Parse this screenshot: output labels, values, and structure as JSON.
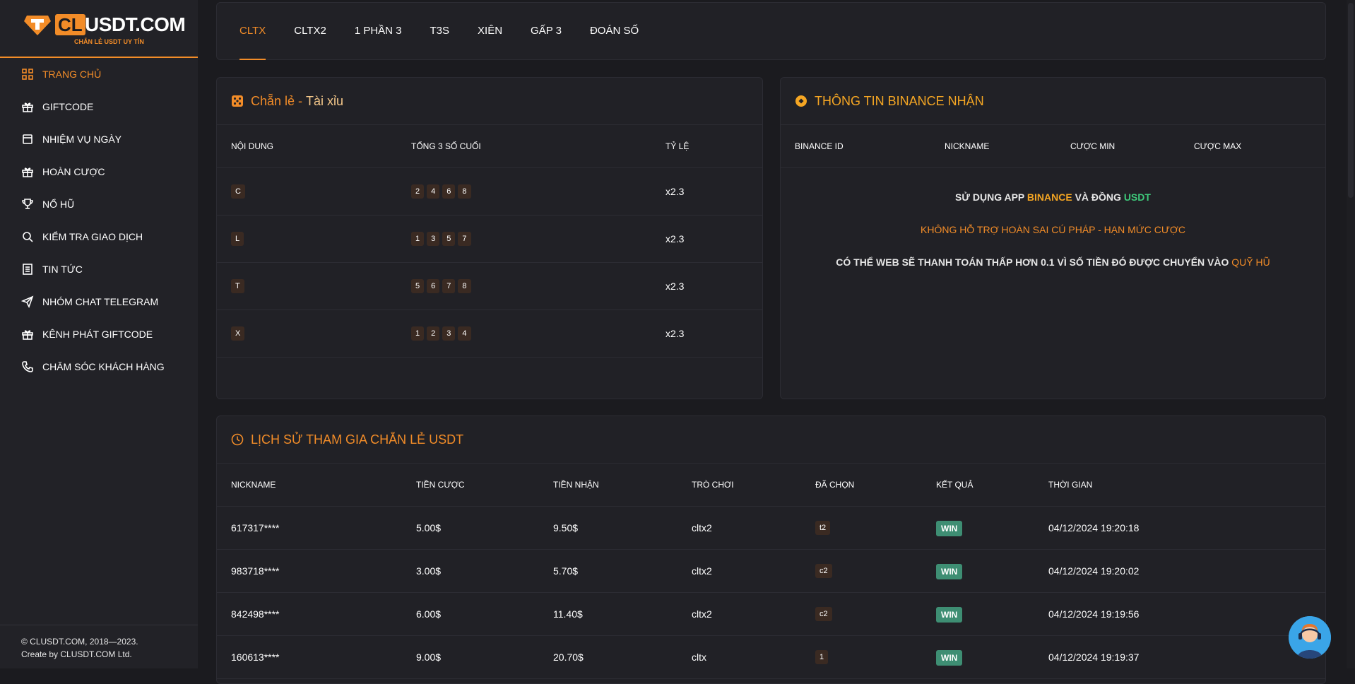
{
  "brand": {
    "logo_cl": "CL",
    "logo_rest": "USDT.COM",
    "tagline": "CHẴN LẺ USDT UY TÍN"
  },
  "sidebar": {
    "items": [
      {
        "label": "TRANG CHỦ",
        "icon": "grid-icon",
        "active": true
      },
      {
        "label": "GIFTCODE",
        "icon": "gift-icon"
      },
      {
        "label": "NHIỆM VỤ NGÀY",
        "icon": "calendar-icon"
      },
      {
        "label": "HOÀN CƯỢC",
        "icon": "gift-icon"
      },
      {
        "label": "NỔ HŨ",
        "icon": "trophy-icon"
      },
      {
        "label": "KIỂM TRA GIAO DỊCH",
        "icon": "search-icon"
      },
      {
        "label": "TIN TỨC",
        "icon": "news-icon"
      },
      {
        "label": "NHÓM CHAT TELEGRAM",
        "icon": "send-icon"
      },
      {
        "label": "KÊNH PHÁT GIFTCODE",
        "icon": "gift-icon"
      },
      {
        "label": "CHĂM SÓC KHÁCH HÀNG",
        "icon": "phone-icon"
      }
    ],
    "footer_line1": "© CLUSDT.COM, 2018—2023.",
    "footer_line2": "Create by CLUSDT.COM Ltd."
  },
  "tabs": [
    "CLTX",
    "CLTX2",
    "1 PHẦN 3",
    "T3S",
    "XIÊN",
    "GẤP 3",
    "ĐOÁN SỐ"
  ],
  "rules": {
    "title_a": "Chẵn lẻ",
    "title_sep": " - ",
    "title_b": "Tài xỉu",
    "headers": [
      "NỘI DUNG",
      "TỔNG 3 SỐ CUỐI",
      "TỶ LỆ"
    ],
    "rows": [
      {
        "content": "C",
        "numbers": [
          "2",
          "4",
          "6",
          "8"
        ],
        "ratio": "x2.3"
      },
      {
        "content": "L",
        "numbers": [
          "1",
          "3",
          "5",
          "7"
        ],
        "ratio": "x2.3"
      },
      {
        "content": "T",
        "numbers": [
          "5",
          "6",
          "7",
          "8"
        ],
        "ratio": "x2.3"
      },
      {
        "content": "X",
        "numbers": [
          "1",
          "2",
          "3",
          "4"
        ],
        "ratio": "x2.3"
      }
    ]
  },
  "binance": {
    "title": "THÔNG TIN BINANCE NHẬN",
    "headers": [
      "BINANCE ID",
      "NICKNAME",
      "CƯỢC MIN",
      "CƯỢC MAX"
    ],
    "line1_a": "SỬ DỤNG APP ",
    "line1_b": "BINANCE",
    "line1_c": " VÀ ĐỒNG ",
    "line1_d": "USDT",
    "line2": "KHÔNG HỖ TRỢ HOÀN SAI CÚ PHÁP - HẠN MỨC CƯỢC",
    "line3_a": "CÓ THỂ WEB SẼ THANH TOÁN THẤP HƠN 0.1 VÌ SỐ TIỀN ĐÓ ĐƯỢC CHUYỂN VÀO ",
    "line3_b": "QUỸ HŨ"
  },
  "history": {
    "title": "LỊCH SỬ THAM GIA CHẴN LẺ USDT",
    "headers": [
      "NICKNAME",
      "TIỀN CƯỢC",
      "TIỀN NHẬN",
      "TRÒ CHƠI",
      "ĐÃ CHỌN",
      "KẾT QUẢ",
      "THỜI GIAN"
    ],
    "rows": [
      {
        "nickname": "617317****",
        "bet": "5.00$",
        "receive": "9.50$",
        "game": "cltx2",
        "choice": "t2",
        "result": "WIN",
        "time": "04/12/2024 19:20:18"
      },
      {
        "nickname": "983718****",
        "bet": "3.00$",
        "receive": "5.70$",
        "game": "cltx2",
        "choice": "c2",
        "result": "WIN",
        "time": "04/12/2024 19:20:02"
      },
      {
        "nickname": "842498****",
        "bet": "6.00$",
        "receive": "11.40$",
        "game": "cltx2",
        "choice": "c2",
        "result": "WIN",
        "time": "04/12/2024 19:19:56"
      },
      {
        "nickname": "160613****",
        "bet": "9.00$",
        "receive": "20.70$",
        "game": "cltx",
        "choice": "1",
        "result": "WIN",
        "time": "04/12/2024 19:19:37"
      }
    ]
  },
  "colors": {
    "accent": "#f28c28",
    "win": "#3e8e73",
    "binance": "#f5a623",
    "usdt": "#3ec97a"
  }
}
